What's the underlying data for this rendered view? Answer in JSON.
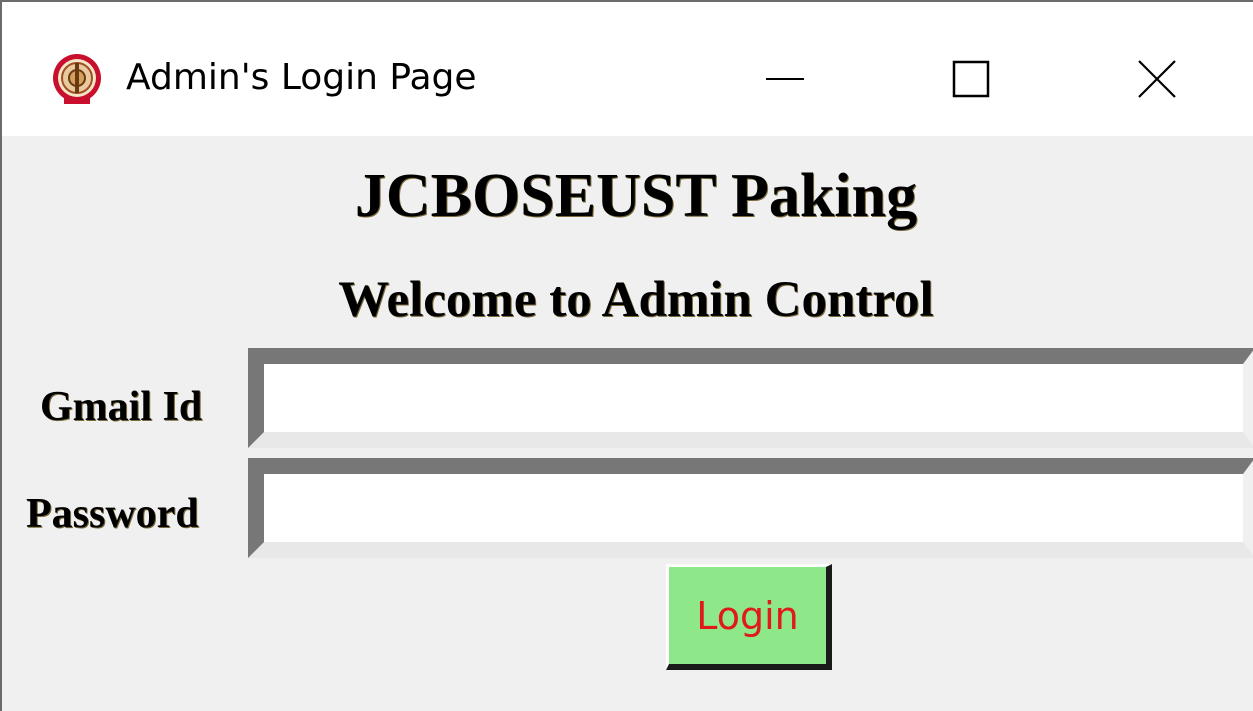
{
  "window": {
    "title": "Admin's Login Page",
    "icon": "university-seal-icon",
    "controls": {
      "minimize": "minimize-icon",
      "maximize": "maximize-icon",
      "close": "close-icon"
    }
  },
  "header": {
    "title": "JCBOSEUST Paking",
    "subtitle": "Welcome to Admin Control"
  },
  "form": {
    "gmail_label": "Gmail Id",
    "gmail_value": "",
    "password_label": "Password",
    "password_value": "",
    "login_label": "Login"
  },
  "colors": {
    "login_bg": "#8ee88a",
    "login_text": "#e01a1a",
    "window_bg": "#f0f0f0"
  }
}
